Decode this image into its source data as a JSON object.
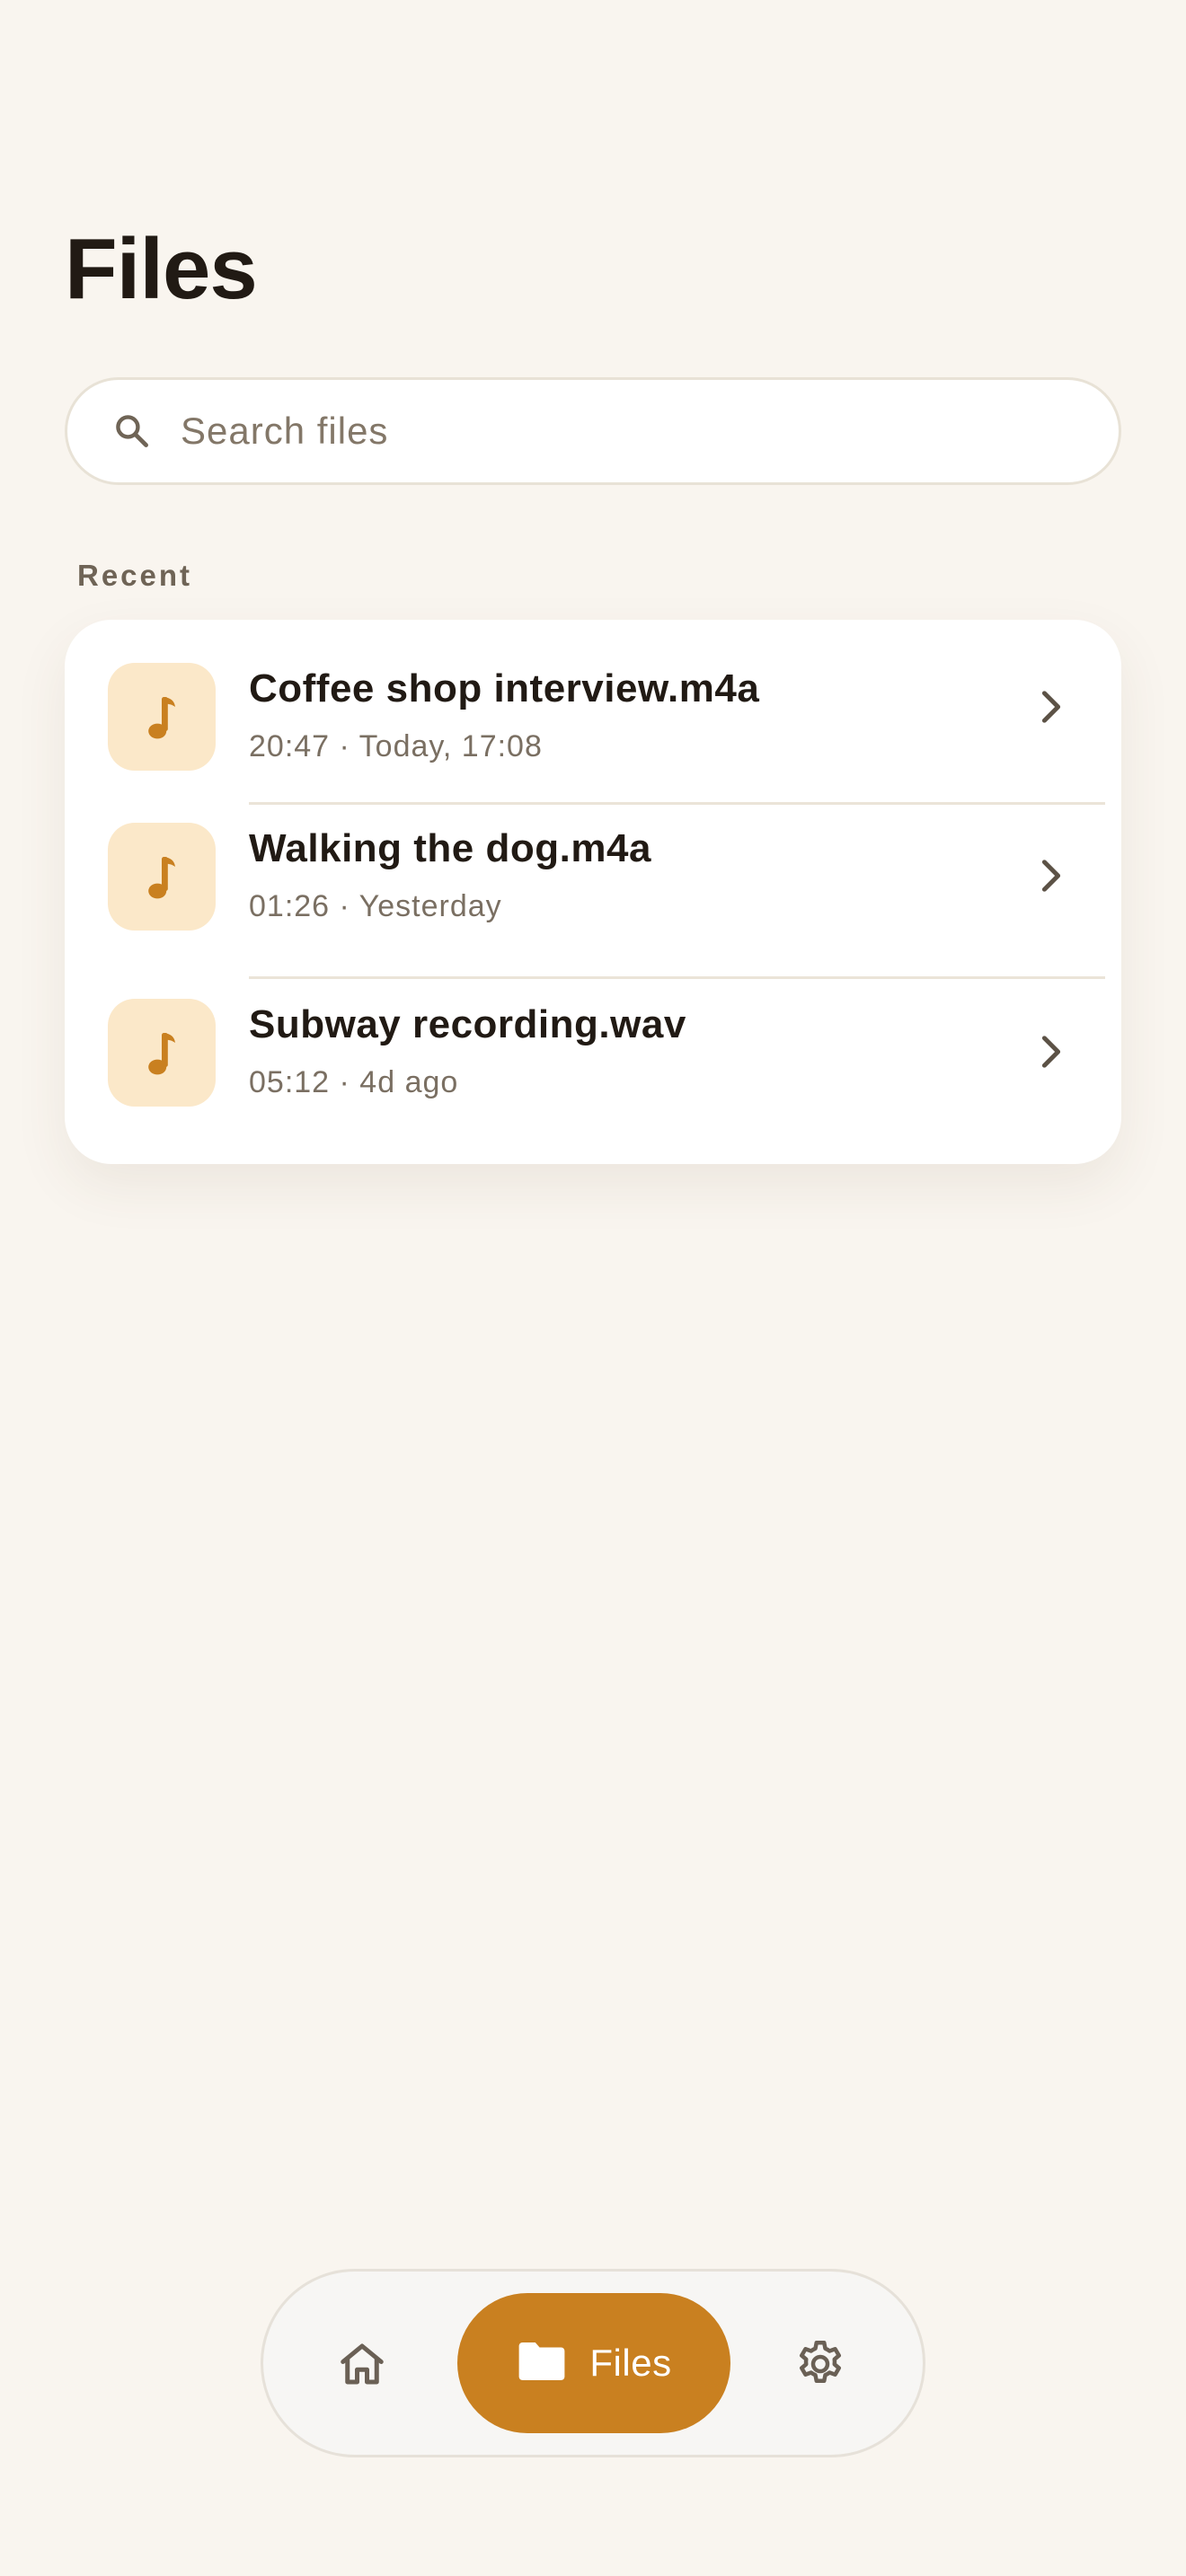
{
  "header": {
    "title": "Files"
  },
  "search": {
    "placeholder": "Search files",
    "value": ""
  },
  "recent": {
    "label": "Recent",
    "items": [
      {
        "name": "Coffee shop interview.m4a",
        "meta": "20:47 · Today, 17:08",
        "icon": "music-note-icon"
      },
      {
        "name": "Walking the dog.m4a",
        "meta": "01:26 · Yesterday",
        "icon": "music-note-icon"
      },
      {
        "name": "Subway recording.wav",
        "meta": "05:12 · 4d ago",
        "icon": "music-note-icon"
      }
    ]
  },
  "nav": {
    "items": [
      {
        "id": "home",
        "icon": "home-icon",
        "active": false
      },
      {
        "id": "files",
        "icon": "folder-icon",
        "label": "Files",
        "active": true
      },
      {
        "id": "settings",
        "icon": "gear-icon",
        "active": false
      }
    ]
  },
  "colors": {
    "background": "#f9f5ef",
    "accent": "#c98020",
    "thumb_bg": "#fbe8c9",
    "text_primary": "#211a14",
    "text_secondary": "#7a6f62"
  }
}
